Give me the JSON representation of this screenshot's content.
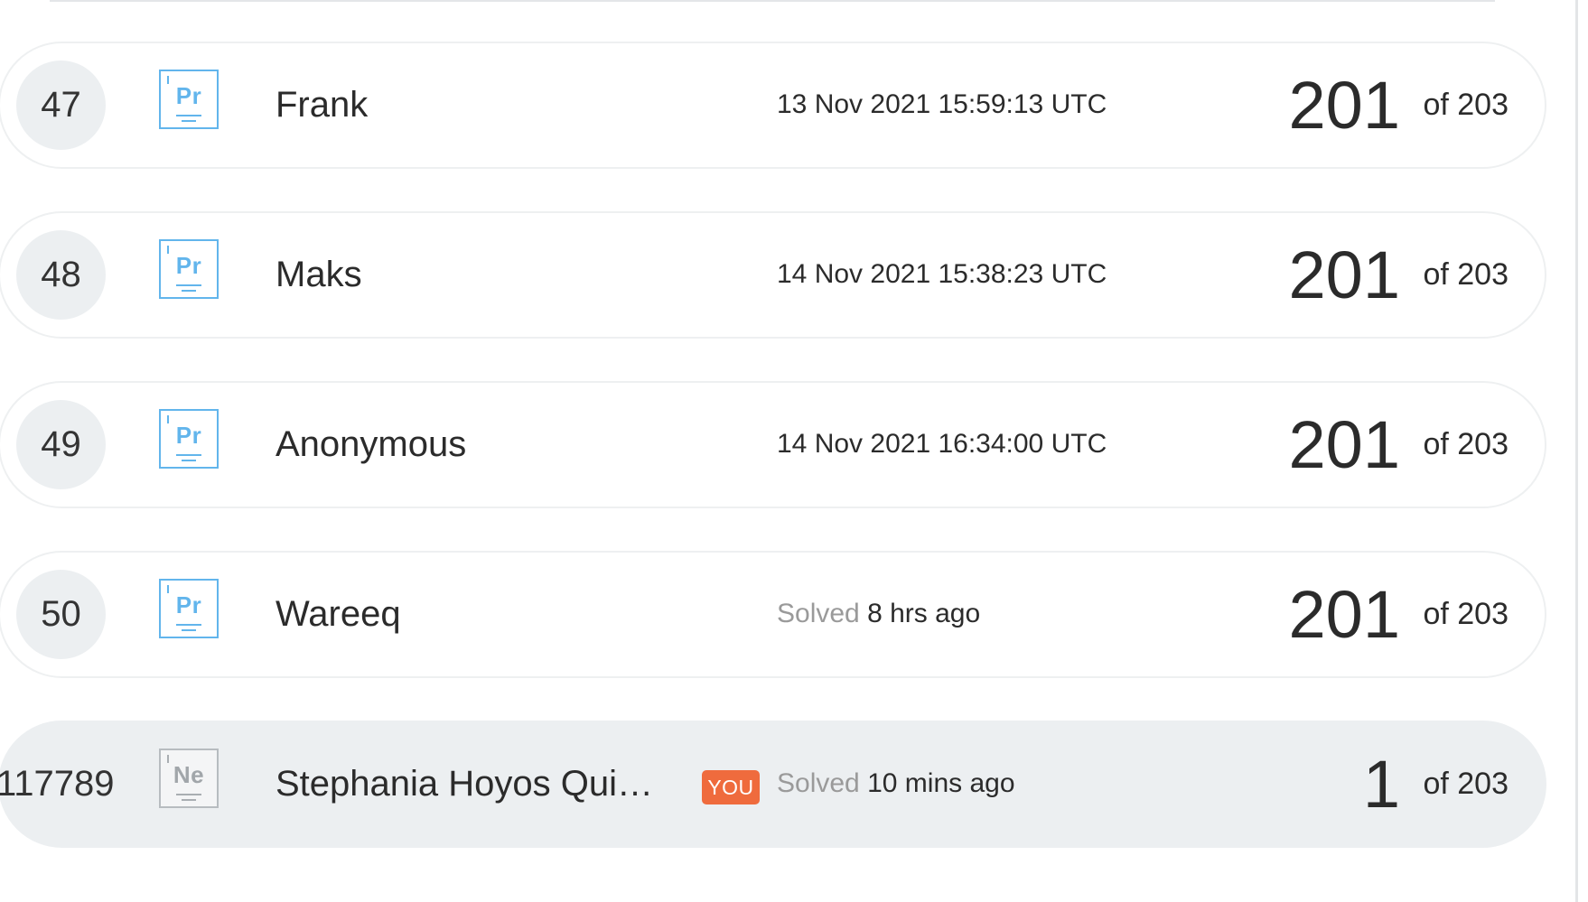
{
  "leaderboard": {
    "rows": [
      {
        "rank": "47",
        "level_symbol": "Pr",
        "name": "Frank",
        "time": "13 Nov 2021 15:59:13 UTC",
        "score": "201",
        "of_total": "of 203"
      },
      {
        "rank": "48",
        "level_symbol": "Pr",
        "name": "Maks",
        "time": "14 Nov 2021 15:38:23 UTC",
        "score": "201",
        "of_total": "of 203"
      },
      {
        "rank": "49",
        "level_symbol": "Pr",
        "name": "Anonymous",
        "time": "14 Nov 2021 16:34:00 UTC",
        "score": "201",
        "of_total": "of 203"
      },
      {
        "rank": "50",
        "level_symbol": "Pr",
        "name": "Wareeq",
        "time_prefix": "Solved",
        "time": "8 hrs ago",
        "score": "201",
        "of_total": "of 203"
      }
    ],
    "current_user": {
      "rank": "117789",
      "level_symbol": "Ne",
      "name": "Stephania Hoyos Quintero",
      "you_badge": "YOU",
      "time_prefix": "Solved",
      "time": "10 mins ago",
      "score": "1",
      "of_total": "of 203"
    },
    "colors": {
      "level_pr": "#62b5ec",
      "level_ne": "#a9aeb2",
      "you_badge": "#ef6b3d",
      "current_row_bg": "#eceff1"
    }
  }
}
